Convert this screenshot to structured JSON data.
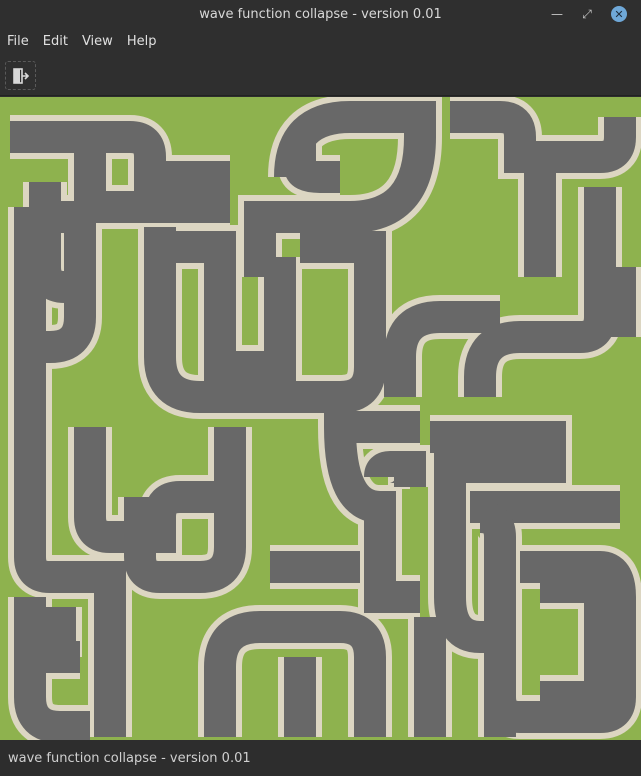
{
  "window": {
    "title": "wave function collapse - version 0.01",
    "controls": {
      "minimize": "minimize-icon",
      "maximize": "maximize-icon",
      "close": "close-icon"
    }
  },
  "menubar": {
    "items": [
      {
        "label": "File"
      },
      {
        "label": "Edit"
      },
      {
        "label": "View"
      },
      {
        "label": "Help"
      }
    ]
  },
  "toolbar": {
    "buttons": [
      {
        "icon": "exit-icon"
      }
    ]
  },
  "canvas": {
    "description_icon": "tile-grid",
    "colors": {
      "background": "#8eb24e",
      "border": "#dcd6c2",
      "road": "#686868"
    }
  },
  "statusbar": {
    "text": "wave function collapse - version 0.01"
  }
}
